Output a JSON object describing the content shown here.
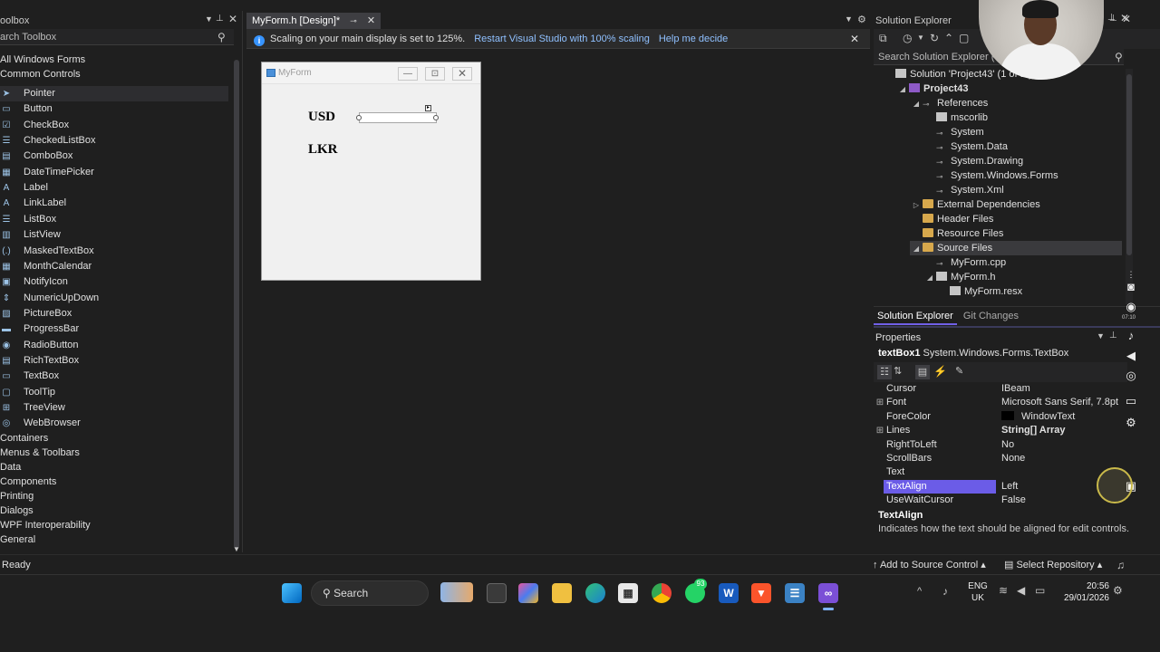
{
  "toolbox": {
    "title": "oolbox",
    "search_placeholder": "arch Toolbox",
    "categories_top": [
      "All Windows Forms",
      "Common Controls"
    ],
    "items": [
      {
        "label": "Pointer",
        "icon": "pointer-icon",
        "glyph": "➤",
        "selected": true
      },
      {
        "label": "Button",
        "icon": "button-icon",
        "glyph": "▭"
      },
      {
        "label": "CheckBox",
        "icon": "checkbox-icon",
        "glyph": "☑"
      },
      {
        "label": "CheckedListBox",
        "icon": "checkedlistbox-icon",
        "glyph": "☰"
      },
      {
        "label": "ComboBox",
        "icon": "combobox-icon",
        "glyph": "▤"
      },
      {
        "label": "DateTimePicker",
        "icon": "datetimepicker-icon",
        "glyph": "▦"
      },
      {
        "label": "Label",
        "icon": "label-icon",
        "glyph": "A"
      },
      {
        "label": "LinkLabel",
        "icon": "linklabel-icon",
        "glyph": "A"
      },
      {
        "label": "ListBox",
        "icon": "listbox-icon",
        "glyph": "☰"
      },
      {
        "label": "ListView",
        "icon": "listview-icon",
        "glyph": "▥"
      },
      {
        "label": "MaskedTextBox",
        "icon": "maskedtextbox-icon",
        "glyph": "(.)"
      },
      {
        "label": "MonthCalendar",
        "icon": "monthcalendar-icon",
        "glyph": "▦"
      },
      {
        "label": "NotifyIcon",
        "icon": "notifyicon-icon",
        "glyph": "▣"
      },
      {
        "label": "NumericUpDown",
        "icon": "numericupdown-icon",
        "glyph": "⇕"
      },
      {
        "label": "PictureBox",
        "icon": "picturebox-icon",
        "glyph": "▨"
      },
      {
        "label": "ProgressBar",
        "icon": "progressbar-icon",
        "glyph": "▬"
      },
      {
        "label": "RadioButton",
        "icon": "radiobutton-icon",
        "glyph": "◉"
      },
      {
        "label": "RichTextBox",
        "icon": "richtextbox-icon",
        "glyph": "▤"
      },
      {
        "label": "TextBox",
        "icon": "textbox-icon",
        "glyph": "▭"
      },
      {
        "label": "ToolTip",
        "icon": "tooltip-icon",
        "glyph": "▢"
      },
      {
        "label": "TreeView",
        "icon": "treeview-icon",
        "glyph": "⊞"
      },
      {
        "label": "WebBrowser",
        "icon": "webbrowser-icon",
        "glyph": "◎"
      }
    ],
    "categories_bottom": [
      "Containers",
      "Menus & Toolbars",
      "Data",
      "Components",
      "Printing",
      "Dialogs",
      "WPF Interoperability",
      "General"
    ]
  },
  "document": {
    "tab_label": "MyForm.h [Design]*",
    "info_message": "Scaling on your main display is set to 125%.",
    "info_link_restart": "Restart Visual Studio with 100% scaling",
    "info_link_help": "Help me decide",
    "form": {
      "title": "MyForm",
      "label_usd": "USD",
      "label_lkr": "LKR"
    }
  },
  "solution_explorer": {
    "title": "Solution Explorer",
    "search_placeholder": "Search Solution Explorer (Ctrl",
    "tree": [
      {
        "label": "Solution 'Project43' (1 of 1 pro",
        "level": 0,
        "expander": "",
        "icon": "solution-icon",
        "cls": "file"
      },
      {
        "label": "Project43",
        "level": 1,
        "expander": "◢",
        "icon": "project-icon",
        "cls": "proj",
        "bold": true
      },
      {
        "label": "References",
        "level": 2,
        "expander": "◢",
        "icon": "references-icon",
        "cls": "ref"
      },
      {
        "label": "mscorlib",
        "level": 3,
        "expander": "",
        "icon": "assembly-icon",
        "cls": "file"
      },
      {
        "label": "System",
        "level": 3,
        "expander": "",
        "icon": "reference-icon",
        "cls": "ref"
      },
      {
        "label": "System.Data",
        "level": 3,
        "expander": "",
        "icon": "reference-icon",
        "cls": "ref"
      },
      {
        "label": "System.Drawing",
        "level": 3,
        "expander": "",
        "icon": "reference-icon",
        "cls": "ref"
      },
      {
        "label": "System.Windows.Forms",
        "level": 3,
        "expander": "",
        "icon": "reference-icon",
        "cls": "ref"
      },
      {
        "label": "System.Xml",
        "level": 3,
        "expander": "",
        "icon": "reference-icon",
        "cls": "ref"
      },
      {
        "label": "External Dependencies",
        "level": 2,
        "expander": "▷",
        "icon": "folder-icon",
        "cls": "fold"
      },
      {
        "label": "Header Files",
        "level": 2,
        "expander": "",
        "icon": "folder-icon",
        "cls": "fold"
      },
      {
        "label": "Resource Files",
        "level": 2,
        "expander": "",
        "icon": "folder-icon",
        "cls": "fold"
      },
      {
        "label": "Source Files",
        "level": 2,
        "expander": "◢",
        "icon": "folder-icon",
        "cls": "fold",
        "selected": true
      },
      {
        "label": "MyForm.cpp",
        "level": 3,
        "expander": "",
        "icon": "cpp-file-icon",
        "cls": "ref"
      },
      {
        "label": "MyForm.h",
        "level": 3,
        "expander": "◢",
        "icon": "header-file-icon",
        "cls": "file"
      },
      {
        "label": "MyForm.resx",
        "level": 4,
        "expander": "",
        "icon": "resx-file-icon",
        "cls": "file"
      }
    ],
    "tabs": [
      "Solution Explorer",
      "Git Changes"
    ]
  },
  "properties": {
    "title": "Properties",
    "object_name": "textBox1",
    "object_type": "System.Windows.Forms.TextBox",
    "rows": [
      {
        "name": "Cursor",
        "value": "IBeam",
        "expand": ""
      },
      {
        "name": "Font",
        "value": "Microsoft Sans Serif, 7.8pt",
        "expand": "⊞"
      },
      {
        "name": "ForeColor",
        "value": "WindowText",
        "expand": "",
        "swatch": "#000000"
      },
      {
        "name": "Lines",
        "value": "String[] Array",
        "expand": "⊞",
        "bold": true
      },
      {
        "name": "RightToLeft",
        "value": "No",
        "expand": ""
      },
      {
        "name": "ScrollBars",
        "value": "None",
        "expand": ""
      },
      {
        "name": "Text",
        "value": "",
        "expand": ""
      },
      {
        "name": "TextAlign",
        "value": "Left",
        "expand": "",
        "selected": true
      },
      {
        "name": "UseWaitCursor",
        "value": "False",
        "expand": ""
      }
    ],
    "desc_title": "TextAlign",
    "desc_text": "Indicates how the text should be aligned for edit controls."
  },
  "statusbar": {
    "status": "Ready",
    "source_control": "Add to Source Control",
    "repository": "Select Repository"
  },
  "taskbar": {
    "search_label": "Search",
    "lang_top": "ENG",
    "lang_bottom": "UK",
    "time": "20:56",
    "date": "29/01/2026",
    "badge": "93"
  },
  "side_overlay": {
    "timer": "07:10"
  },
  "colors": {
    "accent": "#6b5ce7",
    "link": "#8fc0ff",
    "info": "#3794ff"
  }
}
